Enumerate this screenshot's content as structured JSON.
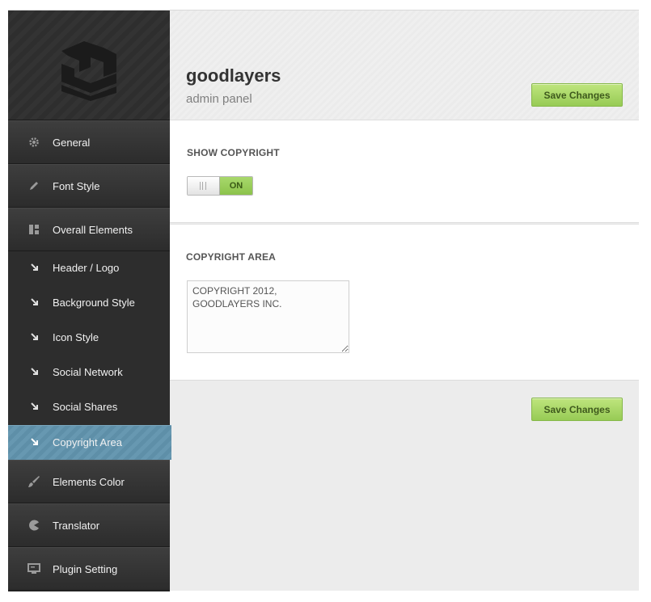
{
  "brand": {
    "title": "goodlayers",
    "subtitle": "admin panel"
  },
  "toolbar": {
    "save_label": "Save Changes"
  },
  "sidebar": {
    "main_top": [
      {
        "label": "General",
        "icon": "gear-icon"
      },
      {
        "label": "Font Style",
        "icon": "pencil-icon"
      },
      {
        "label": "Overall Elements",
        "icon": "layout-icon"
      }
    ],
    "sub": [
      {
        "label": "Header / Logo"
      },
      {
        "label": "Background Style"
      },
      {
        "label": "Icon Style"
      },
      {
        "label": "Social Network"
      },
      {
        "label": "Social Shares"
      },
      {
        "label": "Copyright Area",
        "active": true
      }
    ],
    "main_bottom": [
      {
        "label": "Elements Color",
        "icon": "brush-icon"
      },
      {
        "label": "Translator",
        "icon": "pacman-icon"
      },
      {
        "label": "Plugin Setting",
        "icon": "monitor-icon"
      }
    ]
  },
  "sections": {
    "show_copyright": {
      "title": "SHOW COPYRIGHT",
      "state": "ON"
    },
    "copyright_area": {
      "title": "COPYRIGHT AREA",
      "value": "COPYRIGHT 2012, GOODLAYERS INC."
    }
  },
  "colors": {
    "accent": "#97cb55",
    "active_nav": "#6798b1",
    "sidebar_bg": "#2d2d2d"
  }
}
